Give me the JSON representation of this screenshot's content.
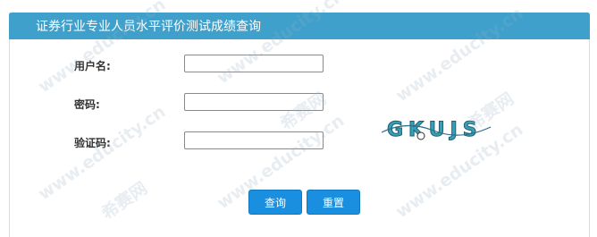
{
  "header": {
    "title": "证券行业专业人员水平评价测试成绩查询"
  },
  "form": {
    "username_label": "用户名:",
    "username_value": "",
    "password_label": "密码:",
    "password_value": "",
    "captcha_label": "验证码:",
    "captcha_value": "",
    "captcha_text": "GKUJS"
  },
  "buttons": {
    "query_label": "查询",
    "reset_label": "重置"
  },
  "watermark": {
    "site": "www.educity.cn",
    "brand": "希赛网"
  },
  "colors": {
    "header_bg": "#3fa1cb",
    "button_bg": "#1a8fe0"
  }
}
